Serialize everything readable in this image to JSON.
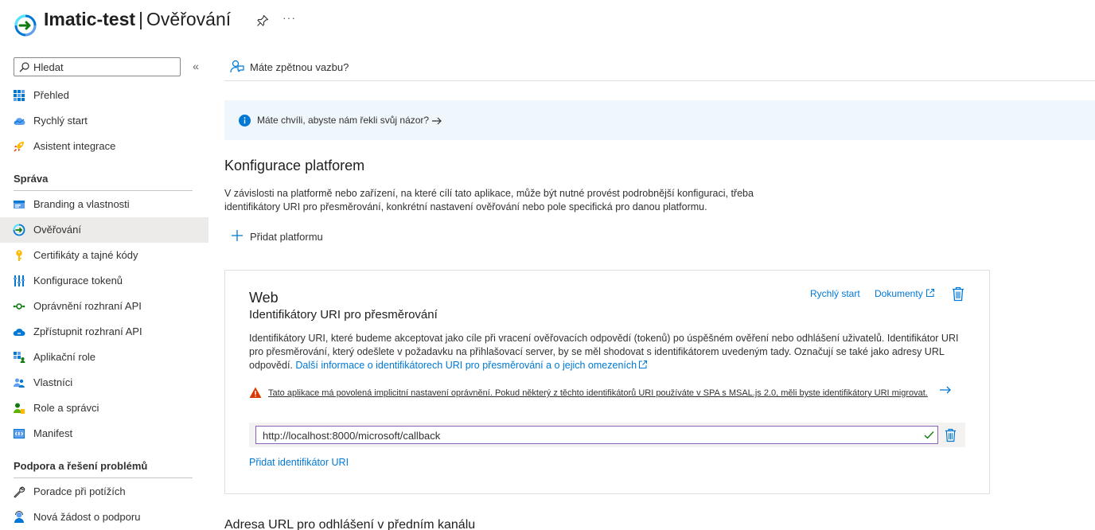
{
  "header": {
    "app_name": "Imatic-test",
    "separator": "|",
    "page_name": "Ověřování",
    "more": "···"
  },
  "sidebar": {
    "search_placeholder": "Hledat",
    "collapse": "«",
    "top_items": [
      {
        "label": "Přehled",
        "icon": "grid-icon"
      },
      {
        "label": "Rychlý start",
        "icon": "cloud-icon"
      },
      {
        "label": "Asistent integrace",
        "icon": "rocket-icon"
      }
    ],
    "section_manage": "Správa",
    "manage_items": [
      {
        "label": "Branding a vlastnosti",
        "icon": "branding-icon"
      },
      {
        "label": "Ověřování",
        "icon": "auth-icon",
        "active": true
      },
      {
        "label": "Certifikáty a tajné kódy",
        "icon": "key-icon"
      },
      {
        "label": "Konfigurace tokenů",
        "icon": "token-icon"
      },
      {
        "label": "Oprávnění rozhraní API",
        "icon": "api-permissions-icon"
      },
      {
        "label": "Zpřístupnit rozhraní API",
        "icon": "expose-api-icon"
      },
      {
        "label": "Aplikační role",
        "icon": "app-roles-icon"
      },
      {
        "label": "Vlastníci",
        "icon": "owners-icon"
      },
      {
        "label": "Role a správci",
        "icon": "roles-admins-icon"
      },
      {
        "label": "Manifest",
        "icon": "manifest-icon"
      }
    ],
    "section_support": "Podpora a řešení problémů",
    "support_items": [
      {
        "label": "Poradce při potížích",
        "icon": "wrench-icon"
      },
      {
        "label": "Nová žádost o podporu",
        "icon": "support-request-icon"
      }
    ]
  },
  "main": {
    "feedback_label": "Máte zpětnou vazbu?",
    "info_banner": "Máte chvíli, abyste nám řekli svůj názor?",
    "title": "Konfigurace platforem",
    "description": "V závislosti na platformě nebo zařízení, na které cílí tato aplikace, může být nutné provést podrobnější konfiguraci, třeba identifikátory URI pro přesměrování, konkrétní nastavení ověřování nebo pole specifická pro danou platformu.",
    "add_platform": "Přidat platformu",
    "card": {
      "title": "Web",
      "subtitle": "Identifikátory URI pro přesměrování",
      "quickstart_link": "Rychlý start",
      "docs_link": "Dokumenty",
      "description": "Identifikátory URI, které budeme akceptovat jako cíle při vracení ověřovacích odpovědí (tokenů) po úspěšném ověření nebo odhlášení uživatelů. Identifikátor URI pro přesměrování, který odešlete v požadavku na přihlašovací server, by se měl shodovat s identifikátorem uvedeným tady. Označují se také jako adresy URL odpovědí.",
      "more_info_link": "Další informace o identifikátorech URI pro přesměrování a o jejich omezeních",
      "warning": "Tato aplikace má povolená implicitní nastavení oprávnění. Pokud některý z těchto identifikátorů URI používáte v SPA s MSAL.js 2.0, měli byste identifikátory URI migrovat.",
      "redirect_uri": "http://localhost:8000/microsoft/callback",
      "add_uri": "Přidat identifikátor URI"
    },
    "next_section_title": "Adresa URL pro odhlášení v předním kanálu"
  },
  "colors": {
    "accent": "#0078d4",
    "warning": "#d83b01",
    "success": "#107c10",
    "active_bg": "#edebe9"
  }
}
